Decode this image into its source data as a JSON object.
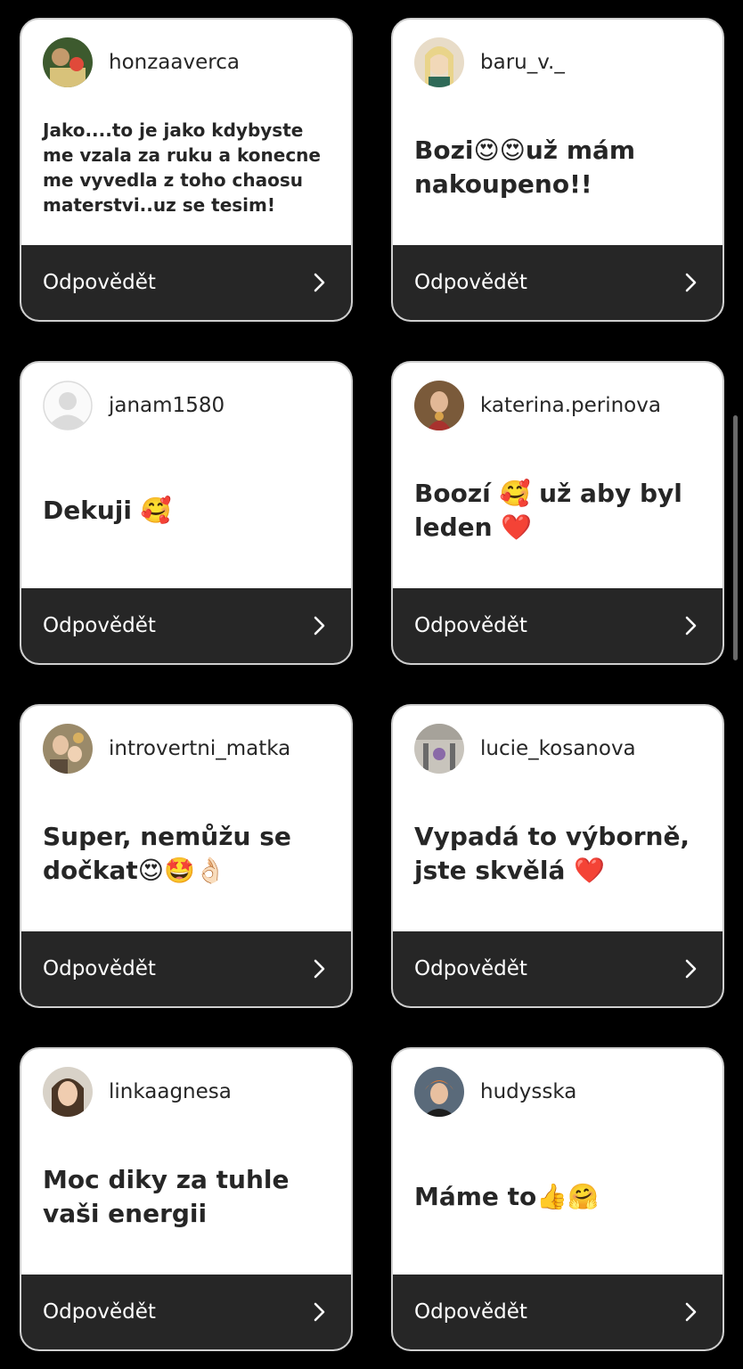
{
  "reply_label": "Odpovědět",
  "cards": [
    {
      "username": "honzaaverca",
      "message": "Jako....to je jako kdybyste me vzala za ruku a konecne me vyvedla z toho chaosu materstvi..uz se tesim!"
    },
    {
      "username": "baru_v._",
      "message": "Bozi😍😍už mám nakoupeno!!"
    },
    {
      "username": "janam1580",
      "message": "Dekuji 🥰"
    },
    {
      "username": "katerina.perinova",
      "message": "Boozí 🥰 už aby byl leden ❤️"
    },
    {
      "username": "introvertni_matka",
      "message": "Super, nemůžu se dočkat😍🤩👌🏻"
    },
    {
      "username": "lucie_kosanova",
      "message": "Vypadá to výborně, jste skvělá ❤️"
    },
    {
      "username": "linkaagnesa",
      "message": "Moc diky za tuhle vaši energii"
    },
    {
      "username": "hudysska",
      "message": "Máme to👍🤗"
    }
  ],
  "colors": {
    "background": "#000000",
    "card": "#ffffff",
    "reply_bar": "#262626",
    "text": "#262626"
  }
}
